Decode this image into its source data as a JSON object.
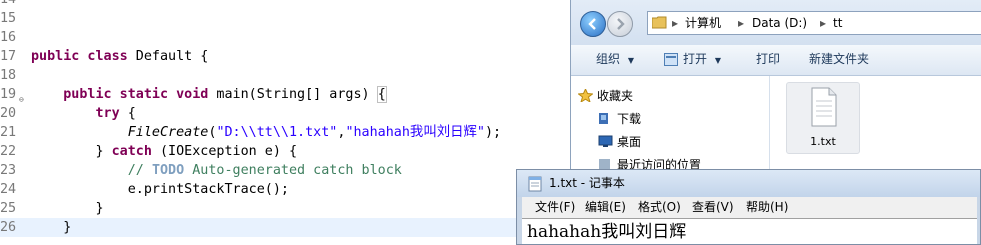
{
  "editor": {
    "lines": [
      {
        "num": "14",
        "segments": []
      },
      {
        "num": "15",
        "segments": []
      },
      {
        "num": "16",
        "segments": []
      },
      {
        "num": "17",
        "segments": [
          {
            "t": "public class",
            "c": "kw"
          },
          {
            "t": " Default {",
            "c": ""
          }
        ]
      },
      {
        "num": "18",
        "segments": []
      },
      {
        "num": "19",
        "fold": true,
        "segments": [
          {
            "t": "    ",
            "c": ""
          },
          {
            "t": "public static void",
            "c": "kw"
          },
          {
            "t": " main(String[] args) ",
            "c": ""
          },
          {
            "t": "{",
            "c": "brk"
          }
        ]
      },
      {
        "num": "20",
        "segments": [
          {
            "t": "        ",
            "c": ""
          },
          {
            "t": "try",
            "c": "kw"
          },
          {
            "t": " {",
            "c": ""
          }
        ]
      },
      {
        "num": "21",
        "segments": [
          {
            "t": "            ",
            "c": ""
          },
          {
            "t": "FileCreate",
            "c": "it"
          },
          {
            "t": "(",
            "c": ""
          },
          {
            "t": "\"D:\\\\tt\\\\1.txt\"",
            "c": "str"
          },
          {
            "t": ",",
            "c": ""
          },
          {
            "t": "\"hahahah我叫刘日辉\"",
            "c": "str"
          },
          {
            "t": ");",
            "c": ""
          }
        ]
      },
      {
        "num": "22",
        "segments": [
          {
            "t": "        } ",
            "c": ""
          },
          {
            "t": "catch",
            "c": "kw"
          },
          {
            "t": " (IOException e) {",
            "c": ""
          }
        ]
      },
      {
        "num": "23",
        "segments": [
          {
            "t": "            ",
            "c": ""
          },
          {
            "t": "// ",
            "c": "cm"
          },
          {
            "t": "TODO",
            "c": "todo"
          },
          {
            "t": " Auto-generated catch block",
            "c": "cm"
          }
        ]
      },
      {
        "num": "24",
        "segments": [
          {
            "t": "            e.printStackTrace();",
            "c": ""
          }
        ]
      },
      {
        "num": "25",
        "segments": [
          {
            "t": "        }",
            "c": ""
          }
        ]
      },
      {
        "num": "26",
        "current": true,
        "segments": [
          {
            "t": "    }",
            "c": ""
          }
        ]
      }
    ]
  },
  "explorer": {
    "breadcrumb": [
      "计算机",
      "Data (D:)",
      "tt"
    ],
    "toolbar": {
      "organize": "组织",
      "open": "打开",
      "print": "打印",
      "new_folder": "新建文件夹"
    },
    "nav": [
      "收藏夹",
      "下载",
      "桌面",
      "最近访问的位置"
    ],
    "file": {
      "name": "1.txt"
    }
  },
  "notepad": {
    "title": "1.txt - 记事本",
    "menus": [
      "文件(F)",
      "编辑(E)",
      "格式(O)",
      "查看(V)",
      "帮助(H)"
    ],
    "content": "hahahah我叫刘日辉"
  },
  "colors": {
    "keyword": "#7f0055",
    "string": "#2a00ff",
    "comment": "#3f7f5f",
    "accent": "#1e395b"
  }
}
